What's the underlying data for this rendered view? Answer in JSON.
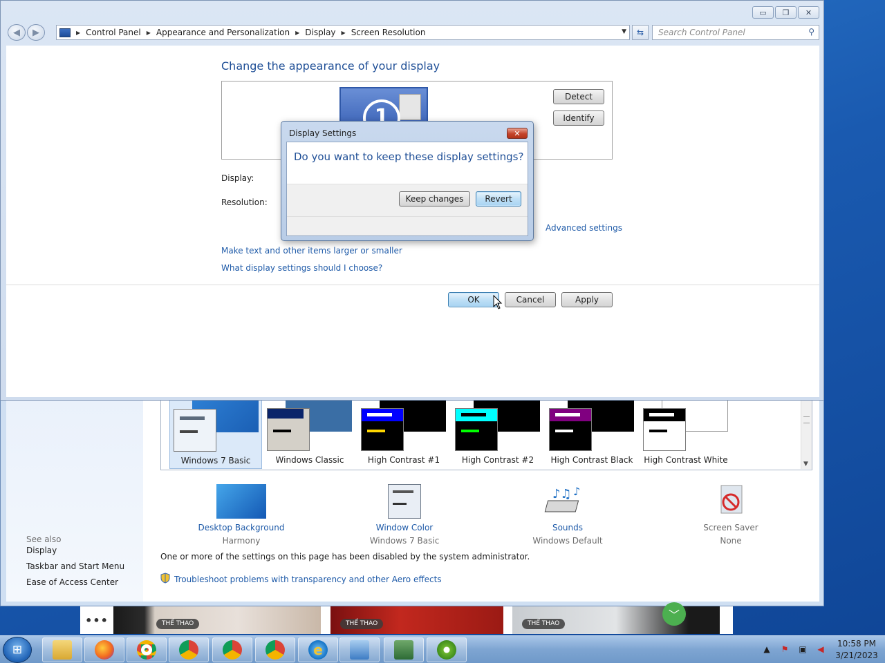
{
  "window": {
    "breadcrumb": [
      "Control Panel",
      "Appearance and Personalization",
      "Display",
      "Screen Resolution"
    ],
    "search_placeholder": "Search Control Panel"
  },
  "screen_resolution": {
    "heading": "Change the appearance of your display",
    "monitor_number": "1",
    "detect_label": "Detect",
    "identify_label": "Identify",
    "display_label": "Display:",
    "resolution_label": "Resolution:",
    "advanced_link": "Advanced settings",
    "text_size_link": "Make text and other items larger or smaller",
    "help_link": "What display settings should I choose?",
    "ok_label": "OK",
    "cancel_label": "Cancel",
    "apply_label": "Apply"
  },
  "dialog": {
    "title": "Display Settings",
    "question": "Do you want to keep these display settings?",
    "keep_label": "Keep changes",
    "revert_label": "Revert",
    "close_glyph": "✕"
  },
  "personalization": {
    "themes": [
      {
        "name": "Windows 7 Basic",
        "selected": true
      },
      {
        "name": "Windows Classic",
        "selected": false
      },
      {
        "name": "High Contrast #1",
        "selected": false
      },
      {
        "name": "High Contrast #2",
        "selected": false
      },
      {
        "name": "High Contrast Black",
        "selected": false
      },
      {
        "name": "High Contrast White",
        "selected": false
      }
    ],
    "items": [
      {
        "label": "Desktop Background",
        "value": "Harmony",
        "icon": "wallpaper-icon"
      },
      {
        "label": "Window Color",
        "value": "Windows 7 Basic",
        "icon": "window-color-icon"
      },
      {
        "label": "Sounds",
        "value": "Windows Default",
        "icon": "sounds-icon"
      },
      {
        "label": "Screen Saver",
        "value": "None",
        "icon": "screen-saver-icon"
      }
    ],
    "admin_note": "One or more of the settings on this page has been disabled by the system administrator.",
    "troubleshoot_link": "Troubleshoot problems with transparency and other Aero effects",
    "see_also_heading": "See also",
    "see_also_links": [
      "Display",
      "Taskbar and Start Menu",
      "Ease of Access Center"
    ]
  },
  "news": {
    "more_glyph": "•••",
    "tags": [
      "THỂ THAO",
      "THỂ THAO",
      "THỂ THAO"
    ]
  },
  "taskbar": {
    "apps": [
      "file-explorer-icon",
      "firefox-icon",
      "chrome-icon",
      "chrome-profile-icon",
      "chrome-profile-icon",
      "chrome-profile-icon",
      "internet-explorer-icon",
      "control-panel-icon",
      "remote-desktop-icon",
      "coccoc-icon"
    ],
    "time": "10:58 PM",
    "date": "3/21/2023"
  }
}
